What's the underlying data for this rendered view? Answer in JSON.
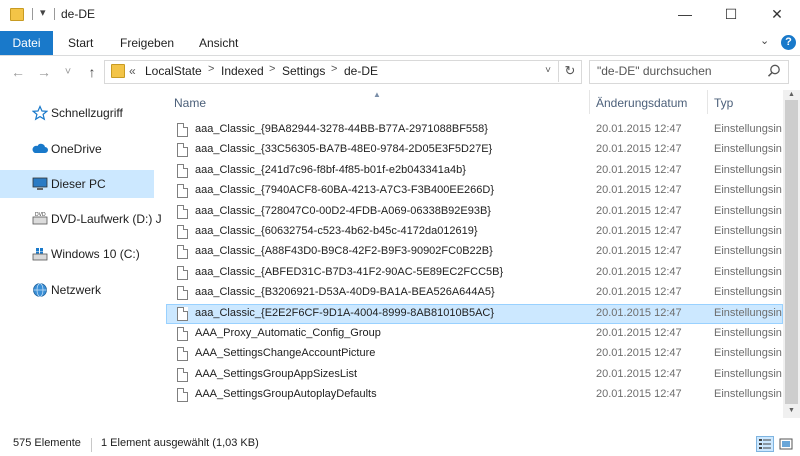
{
  "window": {
    "title": "de-DE",
    "quick_access_chevron": "▾",
    "minimize": "—",
    "maximize": "☐",
    "close": "✕"
  },
  "ribbon": {
    "tabs": [
      "Datei",
      "Start",
      "Freigeben",
      "Ansicht"
    ],
    "expand_chevron": "⌄",
    "help": "?"
  },
  "nav": {
    "back": "←",
    "forward": "→",
    "recent": "˅",
    "up": "↑"
  },
  "address": {
    "overflow": "«",
    "crumbs": [
      "LocalState",
      "Indexed",
      "Settings",
      "de-DE"
    ],
    "separator": ">",
    "dropdown": "˅",
    "refresh": "↻"
  },
  "search": {
    "placeholder": "\"de-DE\" durchsuchen"
  },
  "sidebar": {
    "items": [
      {
        "label": "Schnellzugriff",
        "icon": "star-icon"
      },
      {
        "label": "OneDrive",
        "icon": "cloud-icon"
      },
      {
        "label": "Dieser PC",
        "icon": "computer-icon",
        "selected": true
      },
      {
        "label": "DVD-Laufwerk (D:) J",
        "icon": "dvd-drive-icon"
      },
      {
        "label": "Windows 10 (C:)",
        "icon": "hard-drive-icon"
      },
      {
        "label": "Netzwerk",
        "icon": "network-icon"
      }
    ]
  },
  "columns": {
    "name": "Name",
    "date": "Änderungsdatum",
    "type": "Typ",
    "sort_arrow": "▲"
  },
  "files": [
    {
      "name": "aaa_Classic_{9BA82944-3278-44BB-B77A-2971088BF558}",
      "date": "20.01.2015 12:47",
      "type": "Einstellungsin"
    },
    {
      "name": "aaa_Classic_{33C56305-BA7B-48E0-9784-2D05E3F5D27E}",
      "date": "20.01.2015 12:47",
      "type": "Einstellungsin"
    },
    {
      "name": "aaa_Classic_{241d7c96-f8bf-4f85-b01f-e2b043341a4b}",
      "date": "20.01.2015 12:47",
      "type": "Einstellungsin"
    },
    {
      "name": "aaa_Classic_{7940ACF8-60BA-4213-A7C3-F3B400EE266D}",
      "date": "20.01.2015 12:47",
      "type": "Einstellungsin"
    },
    {
      "name": "aaa_Classic_{728047C0-00D2-4FDB-A069-06338B92E93B}",
      "date": "20.01.2015 12:47",
      "type": "Einstellungsin"
    },
    {
      "name": "aaa_Classic_{60632754-c523-4b62-b45c-4172da012619}",
      "date": "20.01.2015 12:47",
      "type": "Einstellungsin"
    },
    {
      "name": "aaa_Classic_{A88F43D0-B9C8-42F2-B9F3-90902FC0B22B}",
      "date": "20.01.2015 12:47",
      "type": "Einstellungsin"
    },
    {
      "name": "aaa_Classic_{ABFED31C-B7D3-41F2-90AC-5E89EC2FCC5B}",
      "date": "20.01.2015 12:47",
      "type": "Einstellungsin"
    },
    {
      "name": "aaa_Classic_{B3206921-D53A-40D9-BA1A-BEA526A644A5}",
      "date": "20.01.2015 12:47",
      "type": "Einstellungsin"
    },
    {
      "name": "aaa_Classic_{E2E2F6CF-9D1A-4004-8999-8AB81010B5AC}",
      "date": "20.01.2015 12:47",
      "type": "Einstellungsin",
      "selected": true
    },
    {
      "name": "AAA_Proxy_Automatic_Config_Group",
      "date": "20.01.2015 12:47",
      "type": "Einstellungsin"
    },
    {
      "name": "AAA_SettingsChangeAccountPicture",
      "date": "20.01.2015 12:47",
      "type": "Einstellungsin"
    },
    {
      "name": "AAA_SettingsGroupAppSizesList",
      "date": "20.01.2015 12:47",
      "type": "Einstellungsin"
    },
    {
      "name": "AAA_SettingsGroupAutoplayDefaults",
      "date": "20.01.2015 12:47",
      "type": "Einstellungsin"
    }
  ],
  "scrollbar": {
    "up": "▲",
    "down": "▼"
  },
  "status": {
    "count": "575 Elemente",
    "selection": "1 Element ausgewählt (1,03 KB)"
  },
  "colors": {
    "accent": "#1979ca",
    "selection": "#cce8ff",
    "folder": "#f3c447"
  }
}
